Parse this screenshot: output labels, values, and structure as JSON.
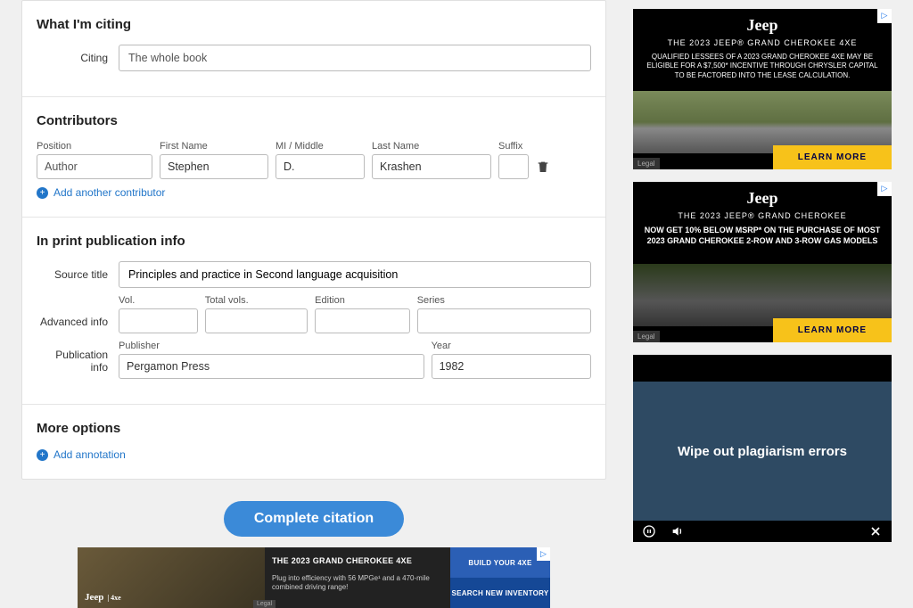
{
  "citing_section": {
    "title": "What I'm citing",
    "label": "Citing",
    "value": "The whole book"
  },
  "contributors": {
    "title": "Contributors",
    "labels": {
      "position": "Position",
      "first_name": "First Name",
      "mi": "MI / Middle",
      "last_name": "Last Name",
      "suffix": "Suffix"
    },
    "row": {
      "position": "Author",
      "first_name": "Stephen",
      "mi": "D.",
      "last_name": "Krashen",
      "suffix": ""
    },
    "add_link": "Add another contributor"
  },
  "print_pub": {
    "title": "In print publication info",
    "source_title_label": "Source title",
    "source_title": "Principles and practice in Second language acquisition",
    "advanced_label": "Advanced info",
    "advanced": {
      "vol_label": "Vol.",
      "vol": "",
      "total_vols_label": "Total vols.",
      "total_vols": "",
      "edition_label": "Edition",
      "edition": "",
      "series_label": "Series",
      "series": ""
    },
    "pubinfo_label": "Publication info",
    "pubinfo": {
      "publisher_label": "Publisher",
      "publisher": "Pergamon Press",
      "year_label": "Year",
      "year": "1982"
    }
  },
  "more_options": {
    "title": "More options",
    "add_annotation": "Add annotation"
  },
  "complete_button": "Complete citation",
  "ads": {
    "a": {
      "brand": "Jeep",
      "headline": "THE 2023 JEEP® GRAND CHEROKEE 4XE",
      "body": "QUALIFIED LESSEES OF A 2023 GRAND CHEROKEE 4XE MAY BE ELIGIBLE FOR A $7,500* INCENTIVE THROUGH CHRYSLER CAPITAL TO BE FACTORED INTO THE LEASE CALCULATION.",
      "cta": "LEARN MORE",
      "legal": "Legal"
    },
    "b": {
      "brand": "Jeep",
      "headline": "THE 2023 JEEP® GRAND CHEROKEE",
      "body": "NOW GET 10% BELOW MSRP* ON THE PURCHASE OF MOST 2023 GRAND CHEROKEE 2-ROW AND 3-ROW GAS MODELS",
      "cta": "LEARN MORE",
      "legal": "Legal"
    },
    "leaderboard": {
      "brand": "Jeep",
      "headline": "THE 2023 GRAND CHEROKEE 4XE",
      "body": "Plug into efficiency with 56 MPGe¹ and a 470-mile combined driving range!",
      "btn1": "BUILD YOUR 4XE",
      "btn2": "SEARCH NEW INVENTORY",
      "legal": "Legal"
    }
  },
  "video": {
    "text": "Wipe out plagiarism errors"
  }
}
